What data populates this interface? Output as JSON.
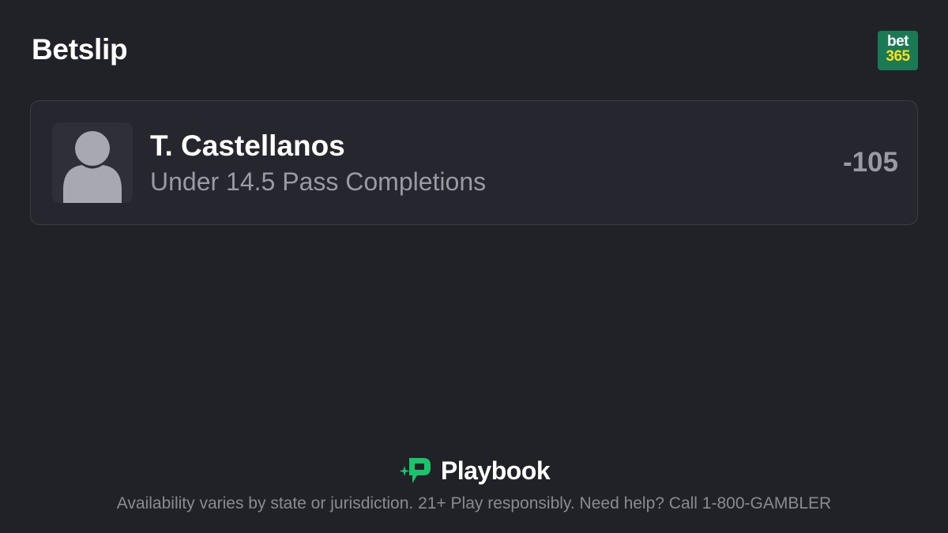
{
  "header": {
    "title": "Betslip",
    "brand_logo": {
      "line1": "bet",
      "line2": "365",
      "bg_color": "#1a7a55",
      "accent_color": "#ffdf1b"
    }
  },
  "bet": {
    "player_name": "T. Castellanos",
    "selection": "Under 14.5 Pass Completions",
    "odds": "-105",
    "avatar_icon": "person-silhouette-icon"
  },
  "footer": {
    "brand_name": "Playbook",
    "brand_icon": "playbook-logo-icon",
    "brand_color": "#19c46b",
    "disclaimer": "Availability varies by state or jurisdiction. 21+ Play responsibly. Need help? Call 1-800-GAMBLER"
  }
}
